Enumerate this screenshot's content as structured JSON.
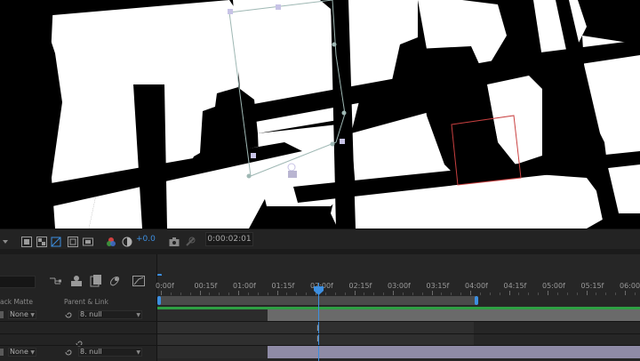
{
  "toolbar": {
    "exposure_value": "+0.0",
    "timecode": "0:00:02:01"
  },
  "left_panel": {
    "columns": {
      "track_matte": "ack Matte",
      "parent_link": "Parent & Link"
    },
    "rows": [
      {
        "matte": "None",
        "parent": "8. null"
      },
      {
        "matte": "None",
        "parent": "8. null"
      }
    ]
  },
  "ruler": {
    "ticks": [
      "0:00f",
      "00:15f",
      "01:00f",
      "01:15f",
      "02:00f",
      "02:15f",
      "03:00f",
      "03:15f",
      "04:00f",
      "04:15f",
      "05:00f",
      "05:15f",
      "06:00f"
    ]
  },
  "colors": {
    "accent_blue": "#3d8fe0",
    "green_bar": "#2ea043",
    "layer_bar_gray": "#6a6a6a",
    "layer_bar_lavender": "#8f8ba6",
    "selection_path": "#9fb8b4",
    "mask_red": "#c94040"
  },
  "icons": {
    "comp_toolbar": [
      "channel-dropdown-icon",
      "region-of-interest-icon",
      "transparency-grid-icon",
      "mask-visibility-icon",
      "safe-zones-icon",
      "fast-previews-icon",
      "color-channels-icon",
      "exposure-icon",
      "snapshot-camera-icon",
      "show-snapshot-icon"
    ],
    "timeline_switches": [
      "draft-3d-icon",
      "comp-flowchart-icon",
      "layer-graph-icon",
      "motion-blur-icon",
      "graph-editor-icon"
    ]
  }
}
